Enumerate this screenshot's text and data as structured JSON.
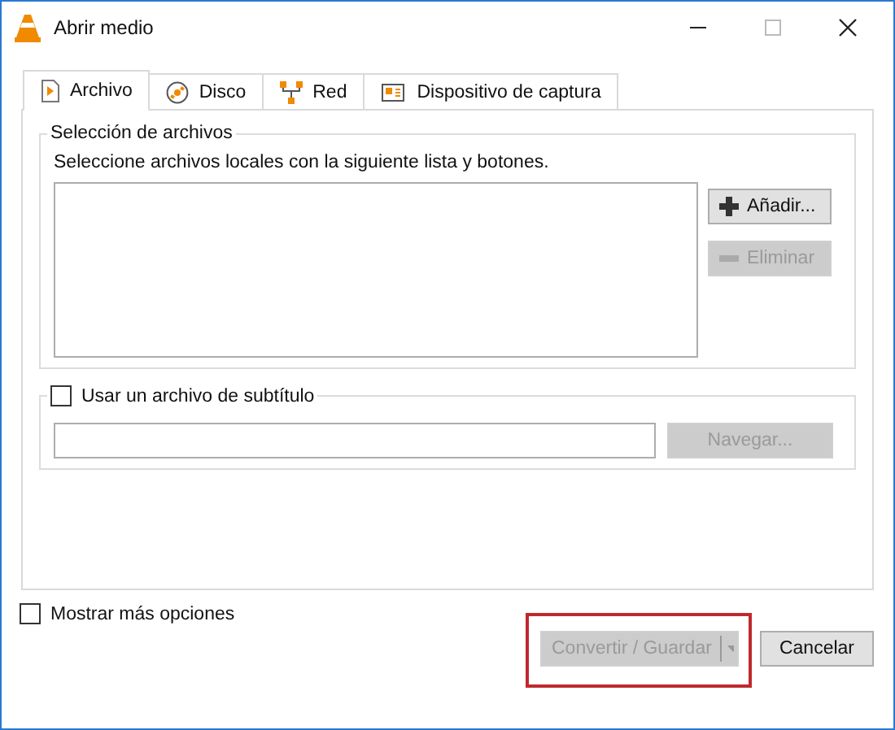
{
  "window": {
    "title": "Abrir medio"
  },
  "tabs": [
    {
      "label": "Archivo",
      "kind": "file",
      "selected": true
    },
    {
      "label": "Disco",
      "kind": "disc",
      "selected": false
    },
    {
      "label": "Red",
      "kind": "network",
      "selected": false
    },
    {
      "label": "Dispositivo de captura",
      "kind": "capture",
      "selected": false
    }
  ],
  "file_selection": {
    "title": "Selección de archivos",
    "hint": "Seleccione archivos locales con la siguiente lista y botones.",
    "buttons": [
      {
        "label": "Añadir...",
        "kind": "add",
        "disabled": false
      },
      {
        "label": "Eliminar",
        "kind": "remove",
        "disabled": true
      }
    ]
  },
  "subtitle": {
    "label": "Usar un archivo de subtítulo",
    "checked": false,
    "browse": {
      "label": "Navegar...",
      "disabled": true
    }
  },
  "more_options": {
    "label": "Mostrar más opciones",
    "checked": false
  },
  "buttons": [
    {
      "label": "Convertir / Guardar",
      "kind": "split",
      "disabled": true,
      "highlighted": true
    },
    {
      "label": "Cancelar",
      "kind": "plain",
      "disabled": false,
      "highlighted": false
    }
  ]
}
